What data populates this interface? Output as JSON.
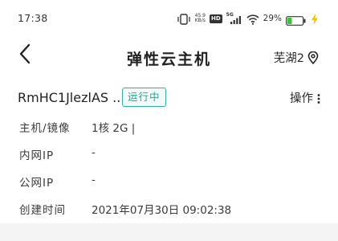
{
  "status_bar": {
    "time": "17:38",
    "net_speed_value": "45.9",
    "net_speed_unit": "KB/s",
    "hd_label": "HD",
    "cell_label": "5G",
    "battery_percent": "29%",
    "battery_level": 0.29,
    "battery_color": "#3cc13b"
  },
  "header": {
    "title": "弹性云主机",
    "region": "芜湖2",
    "back_icon": "chevron-left-icon",
    "location_icon": "location-pin-icon"
  },
  "instance": {
    "name": "RmHC1JlezlAS ...",
    "status": "运行中",
    "status_color": "#1fa892",
    "actions_label": "操作",
    "more_icon": "more-vertical-icon"
  },
  "details": [
    {
      "label": "主机/镜像",
      "value": "1核 2G |"
    },
    {
      "label": "内网IP",
      "value": "-"
    },
    {
      "label": "公网IP",
      "value": "-"
    },
    {
      "label": "创建时间",
      "value": "2021年07月30日  09:02:38"
    }
  ]
}
